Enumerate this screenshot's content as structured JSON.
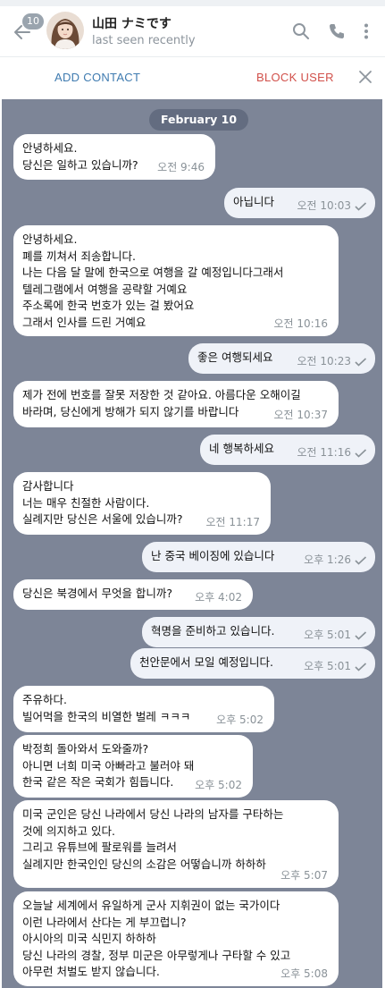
{
  "header": {
    "unread_count": "10",
    "contact_name": "山田 ナミです",
    "status": "last seen recently"
  },
  "actions": {
    "add_contact": "ADD CONTACT",
    "block_user": "BLOCK USER"
  },
  "chat": {
    "date": "February 10",
    "messages": [
      {
        "dir": "in",
        "text": "안녕하세요.\n당신은 일하고 있습니까?",
        "time": "오전 9:46"
      },
      {
        "dir": "out",
        "text": "아닙니다",
        "time": "오전 10:03"
      },
      {
        "dir": "in",
        "text": "안녕하세요.\n폐를 끼쳐서 죄송합니다.\n나는 다음 달 말에 한국으로 여행을 갈 예정입니다그래서\n텔레그램에서 여행을 공략할 거예요\n주소록에 한국 번호가 있는 걸 봤어요\n그래서 인사를 드린 거예요",
        "time": "오전 10:16"
      },
      {
        "dir": "out",
        "text": "좋은 여행되세요",
        "time": "오전 10:23"
      },
      {
        "dir": "in",
        "text": "제가 전에 번호를 잘못 저장한 것 같아요. 아름다운 오해이길\n바라며, 당신에게 방해가 되지 않기를 바랍니다",
        "time": "오전 10:37"
      },
      {
        "dir": "out",
        "text": "네 행복하세요",
        "time": "오전 11:16"
      },
      {
        "dir": "in",
        "text": "감사합니다\n너는 매우 친절한 사람이다.\n실례지만 당신은 서울에 있습니까?",
        "time": "오전 11:17"
      },
      {
        "dir": "out",
        "text": "난 중국 베이징에 있습니다",
        "time": "오후 1:26"
      },
      {
        "dir": "in",
        "text": "당신은 북경에서 무엇을 합니까?",
        "time": "오후 4:02"
      },
      {
        "dir": "out",
        "text": "혁명을 준비하고 있습니다.",
        "time": "오후 5:01"
      },
      {
        "dir": "out",
        "text": "천안문에서 모일 예정입니다.",
        "time": "오후 5:01"
      },
      {
        "dir": "in",
        "text": "주유하다.\n빌어먹을 한국의 비열한 벌레 ㅋㅋㅋ",
        "time": "오후 5:02"
      },
      {
        "dir": "in",
        "text": "박정희 돌아와서 도와줄까?\n아니면 너희 미국 아빠라고 불러야 돼\n한국 같은 작은 국회가 힘듭니다.",
        "time": "오후 5:02"
      },
      {
        "dir": "in",
        "text": "미국 군인은 당신 나라에서 당신 나라의 남자를 구타하는\n것에 의지하고 있다.\n그리고 유튜브에 팔로워를 늘려서\n실례지만 한국인인 당신의 소감은 어떻습니까 하하하",
        "time": "오후 5:07"
      },
      {
        "dir": "in",
        "text": "오늘날 세계에서 유일하게 군사 지휘권이 없는 국가이다\n이런 나라에서 산다는 게 부끄럽니?\n아시아의 미국 식민지 하하하\n당신 나라의 경찰, 정부 미군은 아무렇게나 구타할 수 있고\n아무런 처벌도 받지 않습니다.",
        "time": "오후 5:08"
      }
    ]
  },
  "colors": {
    "chat_background": "#7d8597",
    "incoming_bubble": "#ffffff",
    "outgoing_bubble": "#eff2f8",
    "add_contact": "#3f7bb0",
    "block_user": "#d1504a"
  },
  "icons": [
    "back-arrow-icon",
    "search-icon",
    "phone-icon",
    "more-vert-icon",
    "close-icon",
    "double-check-icon"
  ]
}
